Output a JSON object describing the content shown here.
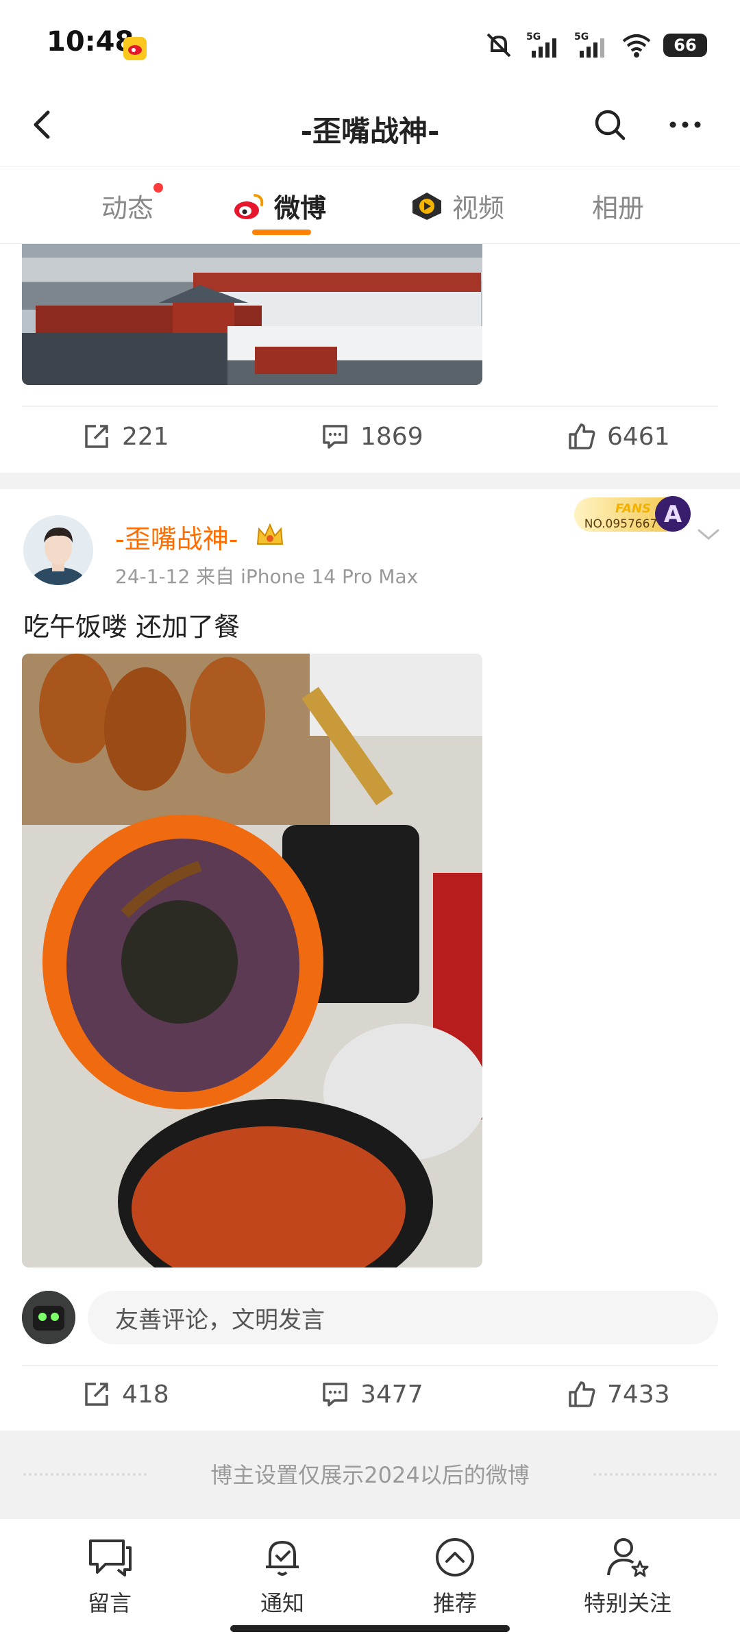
{
  "status": {
    "time": "10:48",
    "battery": "66",
    "net1": "5G",
    "net2": "5G"
  },
  "header": {
    "title": "-歪嘴战神-"
  },
  "tabs": [
    {
      "label": "动态"
    },
    {
      "label": "微博"
    },
    {
      "label": "视频"
    },
    {
      "label": "相册"
    }
  ],
  "post1": {
    "reposts": "221",
    "comments": "1869",
    "likes": "6461"
  },
  "post2": {
    "author": "-歪嘴战神-",
    "meta": "24-1-12  来自 iPhone 14 Pro Max",
    "fans_badge_label": "FANS",
    "fans_badge_no": "NO.0957667",
    "text": "吃午饭喽 还加了餐",
    "comment_placeholder": "友善评论，文明发言",
    "reposts": "418",
    "comments": "3477",
    "likes": "7433"
  },
  "notice": {
    "text": "博主设置仅展示2024以后的微博"
  },
  "bottom_nav": [
    {
      "label": "留言"
    },
    {
      "label": "通知"
    },
    {
      "label": "推荐"
    },
    {
      "label": "特别关注"
    }
  ],
  "colors": {
    "accent": "#ff8200",
    "author": "#ff6d00",
    "dot": "#ff3b3b"
  }
}
